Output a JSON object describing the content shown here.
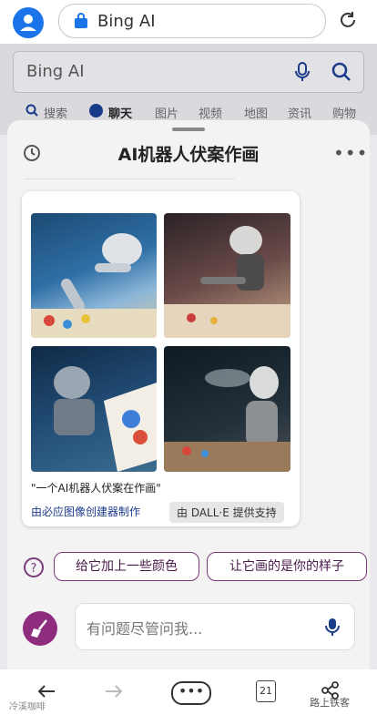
{
  "browser": {
    "url_text": "Bing AI",
    "reload_icon": "reload-icon",
    "avatar_icon": "user-avatar-icon"
  },
  "search": {
    "text": "Bing AI",
    "nav_items": [
      "搜索",
      "聊天",
      "图片",
      "视频",
      "地图",
      "资讯",
      "购物"
    ]
  },
  "chat": {
    "title": "AI机器人伏案作画",
    "images": [
      "robot-painting-1",
      "robot-painting-2",
      "robot-painting-3",
      "robot-painting-4"
    ],
    "caption": "\"一个AI机器人伏案在作画\"",
    "creator_link": "由必应图像创建器制作",
    "dall_badge": "由 DALL·E 提供支持",
    "suggestions": [
      "给它加上一些颜色",
      "让它画的是你的样子"
    ],
    "input_placeholder": "有问题尽管问我..."
  },
  "bottom_bar": {
    "tab_count": "21"
  },
  "watermark": {
    "left": "冷溪咖啡",
    "right": "路上铁客"
  },
  "colors": {
    "accent": "#1a73e8",
    "bing_purple": "#8e2d7d",
    "suggestion_border": "#7a3a7a"
  }
}
